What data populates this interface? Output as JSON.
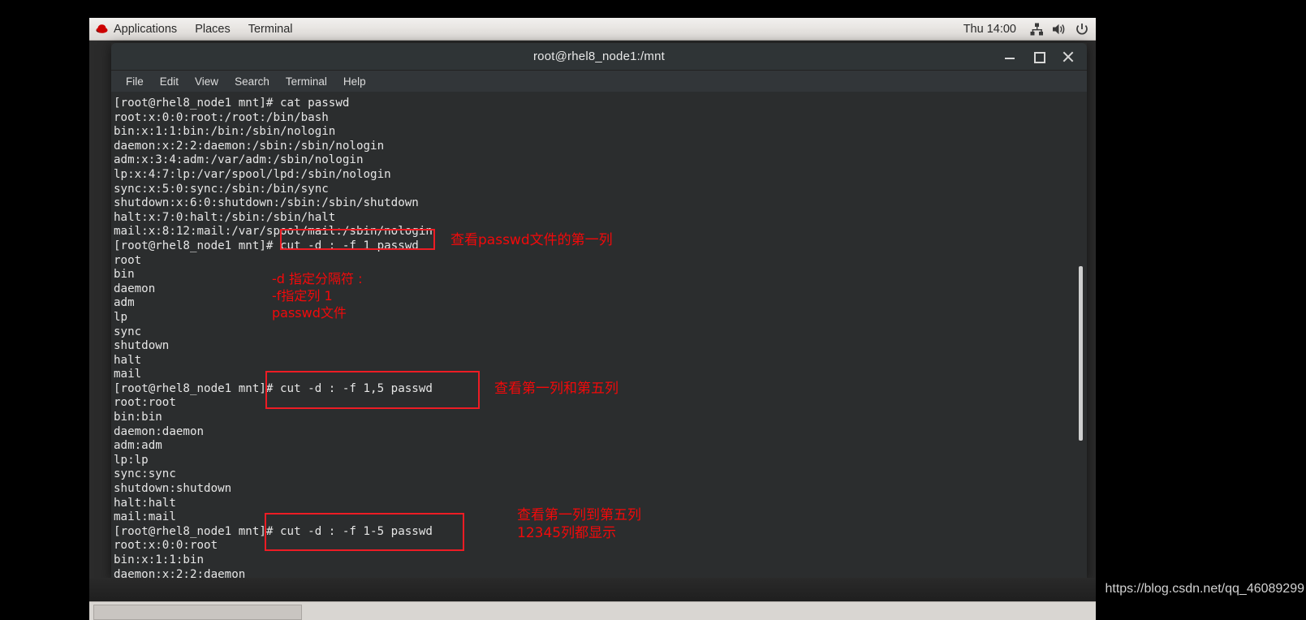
{
  "panel": {
    "logo_icon": "redhat-logo-icon",
    "items": [
      "Applications",
      "Places",
      "Terminal"
    ],
    "clock": "Thu 14:00",
    "tray_icons": [
      "network-icon",
      "volume-icon",
      "power-icon"
    ]
  },
  "window": {
    "title": "root@rhel8_node1:/mnt",
    "buttons": {
      "minimize": "minimize-icon",
      "maximize": "maximize-icon",
      "close": "close-icon"
    },
    "menu": [
      "File",
      "Edit",
      "View",
      "Search",
      "Terminal",
      "Help"
    ]
  },
  "terminal": {
    "lines": [
      "[root@rhel8_node1 mnt]# cat passwd",
      "root:x:0:0:root:/root:/bin/bash",
      "bin:x:1:1:bin:/bin:/sbin/nologin",
      "daemon:x:2:2:daemon:/sbin:/sbin/nologin",
      "adm:x:3:4:adm:/var/adm:/sbin/nologin",
      "lp:x:4:7:lp:/var/spool/lpd:/sbin/nologin",
      "sync:x:5:0:sync:/sbin:/bin/sync",
      "shutdown:x:6:0:shutdown:/sbin:/sbin/shutdown",
      "halt:x:7:0:halt:/sbin:/sbin/halt",
      "mail:x:8:12:mail:/var/spool/mail:/sbin/nologin",
      "[root@rhel8_node1 mnt]# cut -d : -f 1 passwd",
      "root",
      "bin",
      "daemon",
      "adm",
      "lp",
      "sync",
      "shutdown",
      "halt",
      "mail",
      "[root@rhel8_node1 mnt]# cut -d : -f 1,5 passwd",
      "root:root",
      "bin:bin",
      "daemon:daemon",
      "adm:adm",
      "lp:lp",
      "sync:sync",
      "shutdown:shutdown",
      "halt:halt",
      "mail:mail",
      "[root@rhel8_node1 mnt]# cut -d : -f 1-5 passwd",
      "root:x:0:0:root",
      "bin:x:1:1:bin",
      "daemon:x:2:2:daemon"
    ]
  },
  "annotations": {
    "note1": "查看passwd文件的第一列",
    "note2_line1": "-d 指定分隔符 :",
    "note2_line2": "-f指定列 1",
    "note2_line3": "passwd文件",
    "note3": "查看第一列和第五列",
    "note4_line1": "查看第一列到第五列",
    "note4_line2": "12345列都显示",
    "box_color": "#ed1c24",
    "text_color": "#f3090a"
  },
  "taskbar": {
    "item_label": ""
  },
  "watermark": {
    "url": "https://blog.csdn.net/qq_46089299"
  }
}
